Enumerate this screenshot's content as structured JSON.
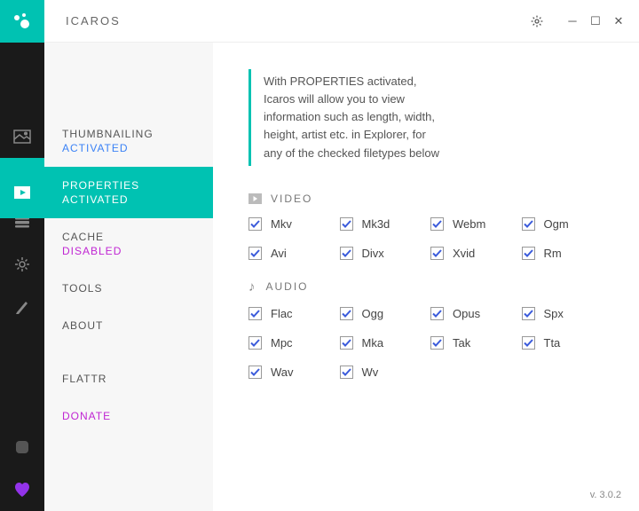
{
  "app": {
    "title": "ICAROS",
    "version": "v. 3.0.2"
  },
  "nav": {
    "thumbnailing": {
      "label": "THUMBNAILING",
      "status": "ACTIVATED"
    },
    "properties": {
      "label": "PROPERTIES",
      "status": "ACTIVATED"
    },
    "cache": {
      "label": "CACHE",
      "status": "DISABLED"
    },
    "tools": {
      "label": "TOOLS"
    },
    "about": {
      "label": "ABOUT"
    },
    "flattr": {
      "label": "FLATTR"
    },
    "donate": {
      "label": "DONATE"
    }
  },
  "description": "With  PROPERTIES activated, Icaros will allow you to view information such as length, width, height, artist etc. in Explorer, for any of the checked filetypes below",
  "sections": {
    "video": {
      "label": "VIDEO",
      "items": [
        "Mkv",
        "Mk3d",
        "Webm",
        "Ogm",
        "Avi",
        "Divx",
        "Xvid",
        "Rm"
      ]
    },
    "audio": {
      "label": "AUDIO",
      "items": [
        "Flac",
        "Ogg",
        "Opus",
        "Spx",
        "Mpc",
        "Mka",
        "Tak",
        "Tta",
        "Wav",
        "Wv"
      ]
    }
  }
}
